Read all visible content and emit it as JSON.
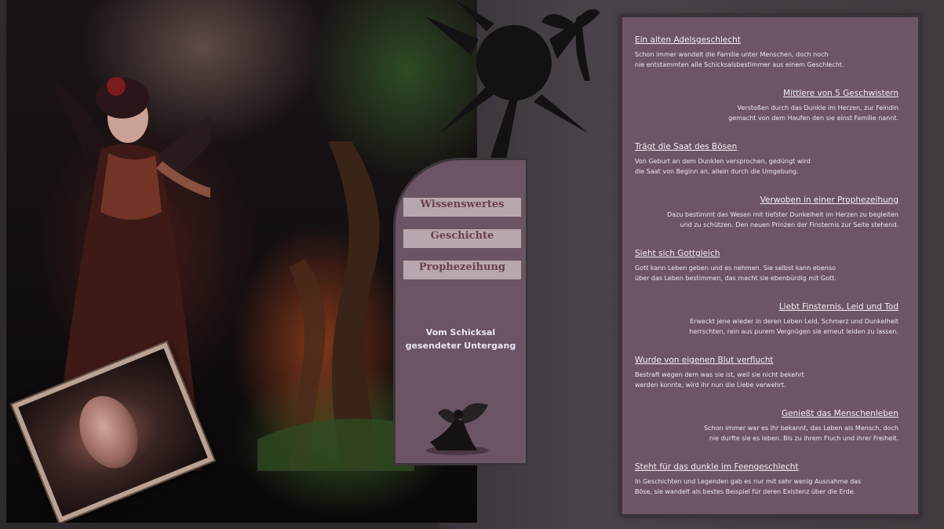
{
  "menu": {
    "items": [
      {
        "label": "Wissenswertes"
      },
      {
        "label": "Geschichte"
      },
      {
        "label": "Prophezeihung"
      }
    ],
    "caption": "Vom Schicksal\ngesendeter Untergang"
  },
  "entries": [
    {
      "title": "Ein alten Adelsgeschlecht",
      "text": "Schon immer wandelt die Familie unter Menschen, doch noch\nnie entstammten alle Schicksalsbestimmer aus einem Geschlecht.",
      "align": "left"
    },
    {
      "title": "Mittlere von 5 Geschwistern",
      "text": "Verstoßen durch das Dunkle im Herzen, zur Feindin\ngemacht von dem Haufen den sie einst Familie nannt.",
      "align": "right"
    },
    {
      "title": "Trägt die Saat des Bösen",
      "text": "Von Geburt an dem Dunklen versprochen, gedüngt wird\ndie Saat von Beginn an, allein durch die Umgebung.",
      "align": "left"
    },
    {
      "title": "Verwoben in einer Prophezeihung",
      "text": "Dazu bestimmt das Wesen mit tiefster Dunkelheit im Herzen zu begleiten\nund zu schützen. Den neuen Prinzen der Finsternis zur Seite stehend.",
      "align": "right"
    },
    {
      "title": "Sieht sich Gottgleich",
      "text": "Gott kann Leben geben und es nehmen. Sie selbst kann ebenso\nüber das Leben bestimmen, das macht sie ebenbürdig mit Gott.",
      "align": "left"
    },
    {
      "title": "Liebt Finsternis, Leid und Tod",
      "text": "Erweckt jene wieder in deren Leben Leid, Schmerz und Dunkelheit\nherrschten, rein aus purem Vergnügen sie erneut leiden zu lassen.",
      "align": "right"
    },
    {
      "title": "Wurde von eigenen Blut verflucht",
      "text": "Bestraft wegen dem was sie ist, weil sie nicht bekehrt\nwerden konnte, wird ihr nun die Liebe verwehrt.",
      "align": "left"
    },
    {
      "title": "Genießt das Menschenleben",
      "text": "Schon immer war es ihr bekannt, das Leben als Mensch, doch\nnie durfte sie es leben. Bis zu ihrem Fluch und ihrer Freiheit.",
      "align": "right"
    },
    {
      "title": "Steht für das dunkle im Feengeschlecht",
      "text": "In Geschichten und Legenden gab es nur mit sehr wenig Ausnahme das\nBöse, sie wandelt als bestes Beispiel für deren Existenz über die Erde.",
      "align": "left"
    }
  ],
  "colors": {
    "panel_bg": "#6e5565",
    "menu_bg": "#6b5463",
    "menu_button_bg": "#b9a7b0",
    "menu_button_text": "#6b3e52",
    "page_bg": "#2e2a2e"
  }
}
